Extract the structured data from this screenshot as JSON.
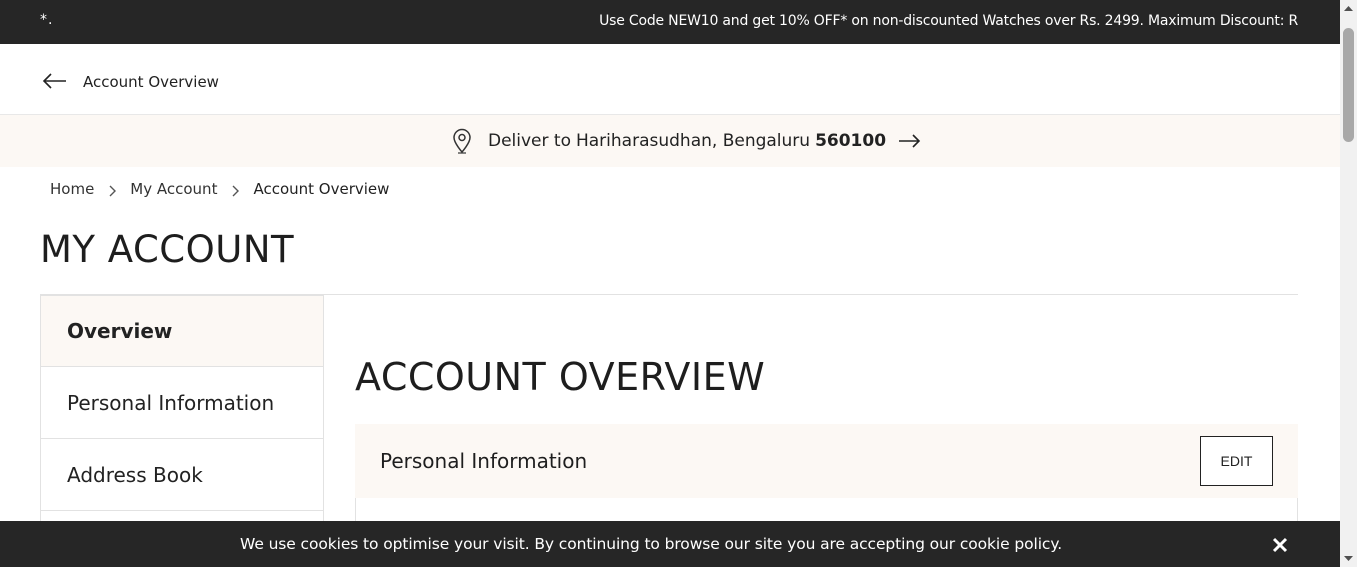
{
  "promo": {
    "left_text": "*.",
    "text": "Use Code NEW10 and get 10% OFF* on non-discounted Watches over Rs. 2499. Maximum Discount: R"
  },
  "header": {
    "back_icon": "arrow-left-icon",
    "title": "Account Overview"
  },
  "deliver": {
    "pin_icon": "location-pin-icon",
    "label": "Deliver to",
    "name": "Hariharasudhan, Bengaluru",
    "pincode": "560100",
    "arrow_icon": "arrow-right-icon"
  },
  "breadcrumb": {
    "items": [
      "Home",
      "My Account",
      "Account Overview"
    ]
  },
  "page": {
    "title": "MY ACCOUNT"
  },
  "sidebar": {
    "items": [
      {
        "label": "Overview",
        "active": true
      },
      {
        "label": "Personal Information",
        "active": false
      },
      {
        "label": "Address Book",
        "active": false
      }
    ]
  },
  "main": {
    "section_title": "ACCOUNT OVERVIEW",
    "card_title": "Personal Information",
    "edit_label": "EDIT"
  },
  "cookie": {
    "text": "We use cookies to optimise your visit. By continuing to browse our site you are accepting our cookie policy.",
    "close_icon": "close-icon"
  },
  "colors": {
    "dark_bar": "#262626",
    "cream_bg": "#fcf8f4",
    "border": "#e2e2e2",
    "text": "#222222"
  }
}
